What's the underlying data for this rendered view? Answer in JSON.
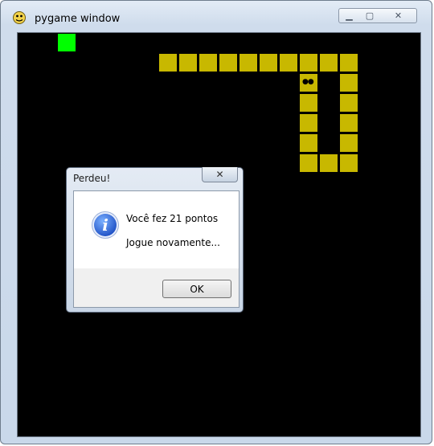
{
  "window": {
    "title": "pygame window",
    "controls": {
      "minimize": "▁",
      "maximize": "▢",
      "close": "✕"
    }
  },
  "game": {
    "background_color": "#000000",
    "food_color": "#00ff00",
    "snake_color": "#c8b800",
    "snake_eyes": "●●"
  },
  "dialog": {
    "title": "Perdeu!",
    "close_symbol": "✕",
    "icon": "info-icon",
    "icon_glyph": "i",
    "message_line1": "Você fez 21 pontos",
    "message_line2": "Jogue novamente...",
    "ok_label": "OK"
  }
}
